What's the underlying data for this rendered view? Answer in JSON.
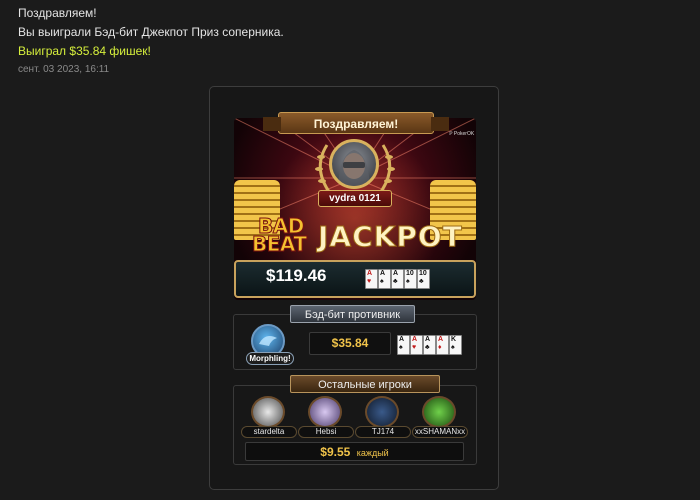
{
  "message": {
    "line1": "Поздравляем!",
    "line2": "Вы выиграли Бэд-бит Джекпот Приз соперника.",
    "line3": "Выиграл $35.84 фишек!",
    "timestamp": "сент. 03 2023, 16:11"
  },
  "banner": {
    "title": "Поздравляем!",
    "brand_mark": "ℙ PokerOK",
    "winner_name": "vydra 0121",
    "logo_bad_line1": "BAD",
    "logo_bad_line2": "BEAT",
    "logo_jackpot": "JACKPOT",
    "prize": "$119.46",
    "hand": [
      {
        "rank": "A",
        "suit": "♥",
        "color": "red"
      },
      {
        "rank": "A",
        "suit": "♠",
        "color": "black"
      },
      {
        "rank": "A",
        "suit": "♣",
        "color": "black"
      },
      {
        "rank": "10",
        "suit": "♠",
        "color": "black"
      },
      {
        "rank": "10",
        "suit": "♣",
        "color": "black"
      }
    ]
  },
  "opponent_section": {
    "header": "Бэд-бит противник",
    "name": "Morphling!",
    "amount": "$35.84",
    "hand": [
      {
        "rank": "A",
        "suit": "♠",
        "color": "black"
      },
      {
        "rank": "A",
        "suit": "♥",
        "color": "red"
      },
      {
        "rank": "A",
        "suit": "♣",
        "color": "black"
      },
      {
        "rank": "A",
        "suit": "♦",
        "color": "red"
      },
      {
        "rank": "K",
        "suit": "♠",
        "color": "black"
      }
    ]
  },
  "others_section": {
    "header": "Остальные игроки",
    "players": [
      {
        "name": "stardelta",
        "avatar_icon": "panda-icon",
        "color": "#c8c8c8"
      },
      {
        "name": "Hebsi",
        "avatar_icon": "skull-3d-glasses-icon",
        "color": "#b8a0d8"
      },
      {
        "name": "TJ174",
        "avatar_icon": "crossed-swords-icon",
        "color": "#3a5a8a"
      },
      {
        "name": "xxSHAMANxx",
        "avatar_icon": "clover-icon",
        "color": "#3fae2a"
      }
    ],
    "each_amount": "$9.55",
    "each_label": "каждый"
  },
  "colors": {
    "highlight_text": "#d6ef3c",
    "gold": "#f0c34a"
  }
}
